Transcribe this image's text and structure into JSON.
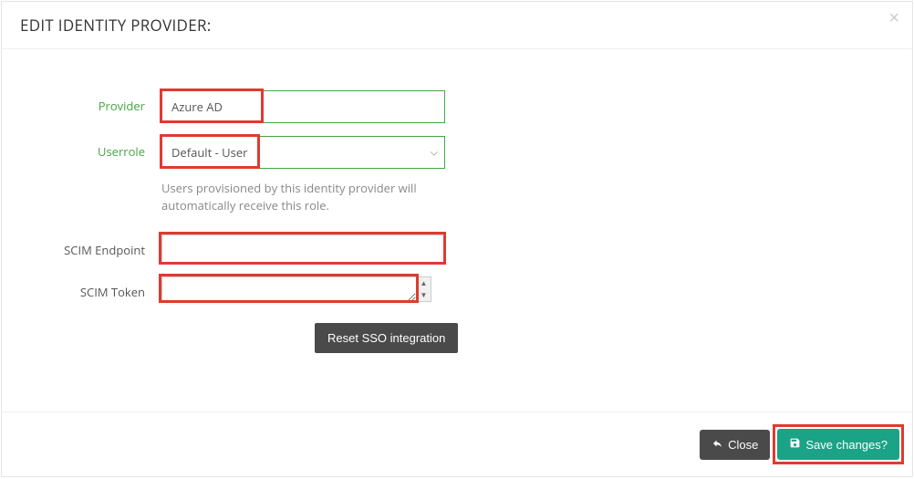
{
  "modal": {
    "title": "EDIT IDENTITY PROVIDER:",
    "close_glyph": "×"
  },
  "form": {
    "provider": {
      "label": "Provider",
      "value": "Azure AD"
    },
    "userrole": {
      "label": "Userrole",
      "selected": "Default - User",
      "help": "Users provisioned by this identity provider will automatically receive this role."
    },
    "scim_endpoint": {
      "label": "SCIM Endpoint",
      "value": ""
    },
    "scim_token": {
      "label": "SCIM Token",
      "value": ""
    },
    "reset_button": "Reset SSO integration"
  },
  "footer": {
    "close": "Close",
    "save": "Save changes?"
  }
}
